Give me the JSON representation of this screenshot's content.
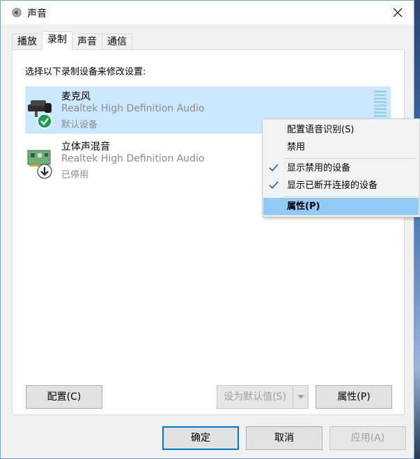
{
  "window": {
    "title": "声音",
    "close_label": "×"
  },
  "tabs": [
    {
      "label": "播放",
      "active": false
    },
    {
      "label": "录制",
      "active": true
    },
    {
      "label": "声音",
      "active": false
    },
    {
      "label": "通信",
      "active": false
    }
  ],
  "panel": {
    "instruction": "选择以下录制设备来修改设置:"
  },
  "devices": [
    {
      "name": "麦克风",
      "description": "Realtek High Definition Audio",
      "status": "默认设备",
      "selected": true,
      "icon": "microphone-icon",
      "badge": "check-badge-icon"
    },
    {
      "name": "立体声混音",
      "description": "Realtek High Definition Audio",
      "status": "已停用",
      "selected": false,
      "icon": "sound-card-icon",
      "badge": "disabled-badge-icon"
    }
  ],
  "context_menu": {
    "items": [
      {
        "label": "配置语音识别(S)",
        "checked": false,
        "highlight": false
      },
      {
        "label": "禁用",
        "checked": false,
        "highlight": false
      },
      {
        "label": "显示禁用的设备",
        "checked": true,
        "highlight": false
      },
      {
        "label": "显示已断开连接的设备",
        "checked": true,
        "highlight": false
      },
      {
        "label": "属性(P)",
        "checked": false,
        "highlight": true
      }
    ]
  },
  "buttons": {
    "configure": "配置(C)",
    "set_default": "设为默认值(S)",
    "properties": "属性(P)",
    "ok": "确定",
    "cancel": "取消",
    "apply": "应用(A)"
  },
  "colors": {
    "selection": "#cce8ff",
    "menu_highlight": "#91c9f7",
    "check_green": "#1aa14b",
    "accent": "#0078d7"
  }
}
